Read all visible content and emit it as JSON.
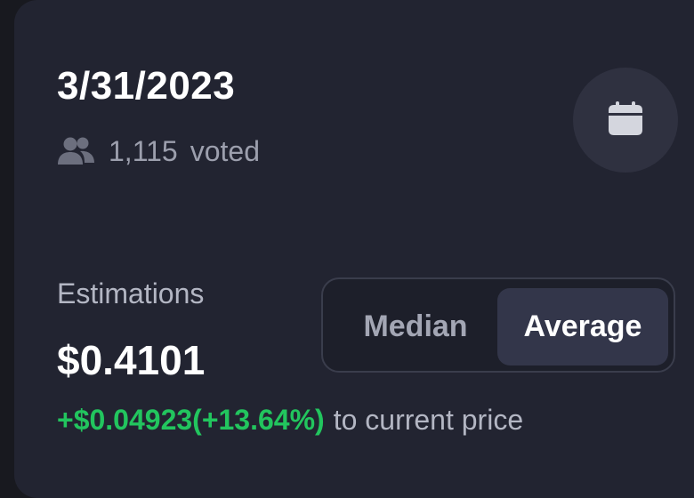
{
  "header": {
    "date": "3/31/2023",
    "votes": {
      "count": "1,115",
      "label": "voted"
    }
  },
  "icons": {
    "users": "users-icon",
    "calendar": "calendar-icon"
  },
  "estimation": {
    "label": "Estimations",
    "value": "$0.4101",
    "change": "+$0.04923(+13.64%)",
    "change_suffix": "to current price"
  },
  "toggle": {
    "options": [
      "Median",
      "Average"
    ],
    "selected": "Average"
  },
  "colors": {
    "card_bg": "#222431",
    "positive": "#22c55e",
    "muted_text": "#9c9fad",
    "selected_bg": "#33364a"
  }
}
